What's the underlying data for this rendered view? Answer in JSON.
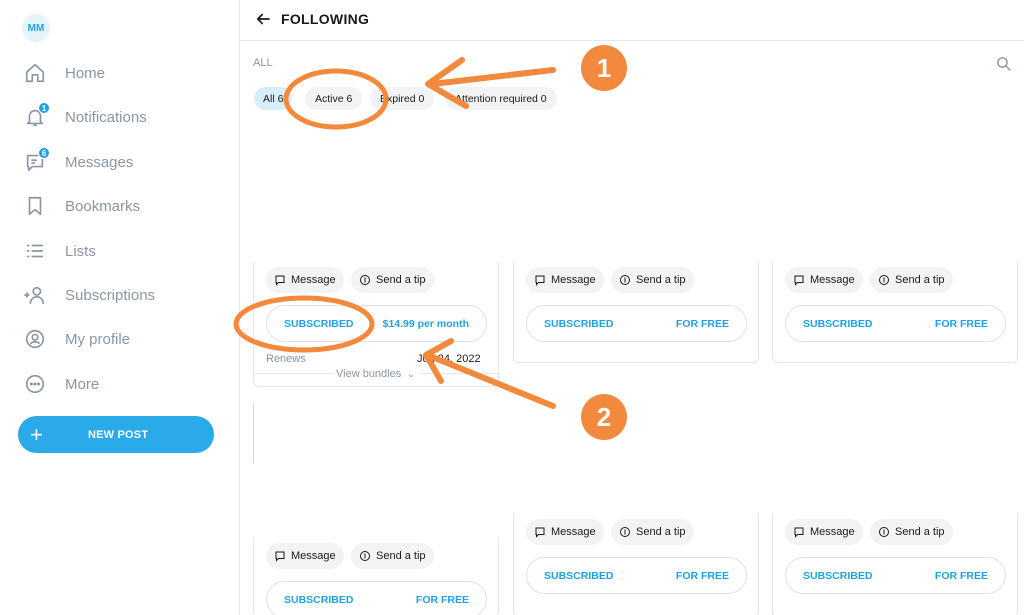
{
  "sidebar": {
    "avatar_initials": "MM",
    "items": [
      {
        "label": "Home",
        "icon": "home-icon"
      },
      {
        "label": "Notifications",
        "icon": "bell-icon",
        "badge": "1"
      },
      {
        "label": "Messages",
        "icon": "chat-icon",
        "badge": "6"
      },
      {
        "label": "Bookmarks",
        "icon": "bookmark-icon"
      },
      {
        "label": "Lists",
        "icon": "list-icon"
      },
      {
        "label": "Subscriptions",
        "icon": "subscriptions-icon"
      },
      {
        "label": "My profile",
        "icon": "profile-icon"
      },
      {
        "label": "More",
        "icon": "more-icon"
      }
    ],
    "new_post_label": "NEW POST"
  },
  "header": {
    "title": "FOLLOWING"
  },
  "filter": {
    "section_label": "ALL",
    "chips": [
      {
        "label": "All 6",
        "selected": true
      },
      {
        "label": "Active 6"
      },
      {
        "label": "Expired 0"
      },
      {
        "label": "Attention required 0"
      }
    ]
  },
  "cards": [
    {
      "message": "Message",
      "tip": "Send a tip",
      "status": "SUBSCRIBED",
      "price": "$14.99 per month",
      "renews": "Renews",
      "renew_date": "Jun 24, 2022",
      "bundles": "View bundles"
    },
    {
      "message": "Message",
      "tip": "Send a tip",
      "status": "SUBSCRIBED",
      "price": "FOR FREE"
    },
    {
      "message": "Message",
      "tip": "Send a tip",
      "status": "SUBSCRIBED",
      "price": "FOR FREE"
    },
    {
      "message": "Message",
      "tip": "Send a tip",
      "status": "SUBSCRIBED",
      "price": "FOR FREE"
    },
    {
      "message": "Message",
      "tip": "Send a tip",
      "status": "SUBSCRIBED",
      "price": "FOR FREE"
    },
    {
      "message": "Message",
      "tip": "Send a tip",
      "status": "SUBSCRIBED",
      "price": "FOR FREE"
    }
  ],
  "annotations": {
    "marker_1": "1",
    "marker_2": "2"
  },
  "colors": {
    "accent": "#1fa3e0",
    "annotation": "#f2893d"
  }
}
